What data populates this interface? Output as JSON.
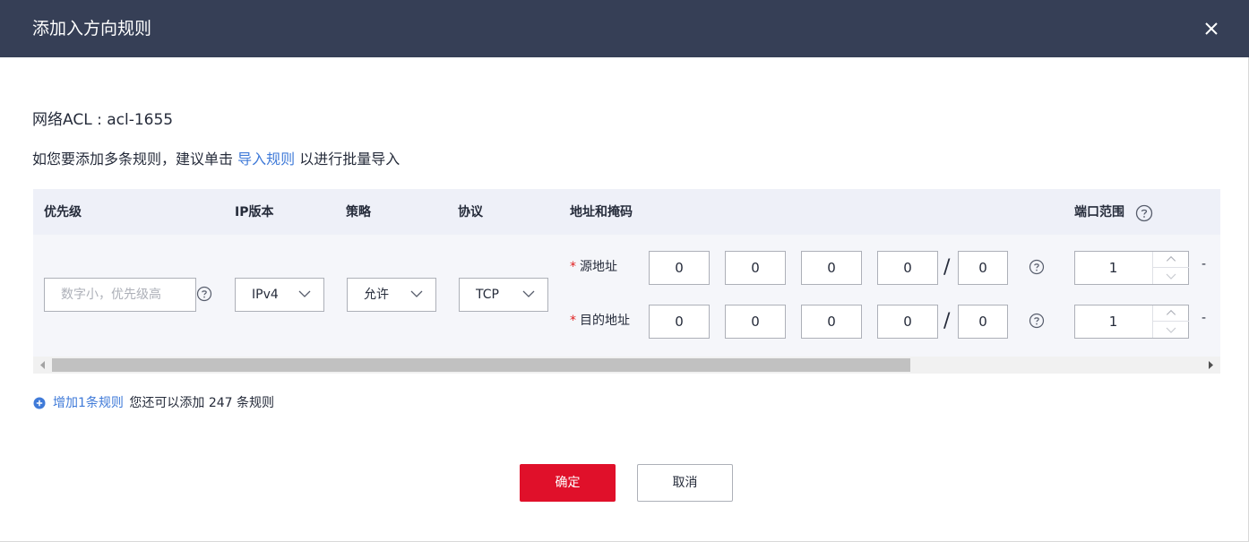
{
  "dialog": {
    "title": "添加入方向规则",
    "acl_label": "网络ACL : acl-1655",
    "tip_prefix": "如您要添加多条规则，建议单击 ",
    "tip_link": "导入规则",
    "tip_suffix": " 以进行批量导入"
  },
  "table": {
    "headers": {
      "priority": "优先级",
      "ip_version": "IP版本",
      "policy": "策略",
      "protocol": "协议",
      "address": "地址和掩码",
      "port_range": "端口范围"
    },
    "row": {
      "priority_placeholder": "数字小，优先级高",
      "ip_version": "IPv4",
      "policy": "允许",
      "protocol": "TCP",
      "source_label": "源地址",
      "dest_label": "目的地址",
      "source_octets": [
        "0",
        "0",
        "0",
        "0"
      ],
      "source_mask": "0",
      "dest_octets": [
        "0",
        "0",
        "0",
        "0"
      ],
      "dest_mask": "0",
      "slash": "/",
      "source_port_start": "1",
      "dest_port_start": "1",
      "dash": "-",
      "required_mark": "*"
    }
  },
  "footer": {
    "add_link": "增加1条规则",
    "add_hint": "您还可以添加 247 条规则",
    "confirm": "确定",
    "cancel": "取消"
  },
  "colors": {
    "header_bg": "#363f56",
    "link": "#3f7ad8",
    "primary": "#e0102a",
    "required": "#e02020"
  }
}
